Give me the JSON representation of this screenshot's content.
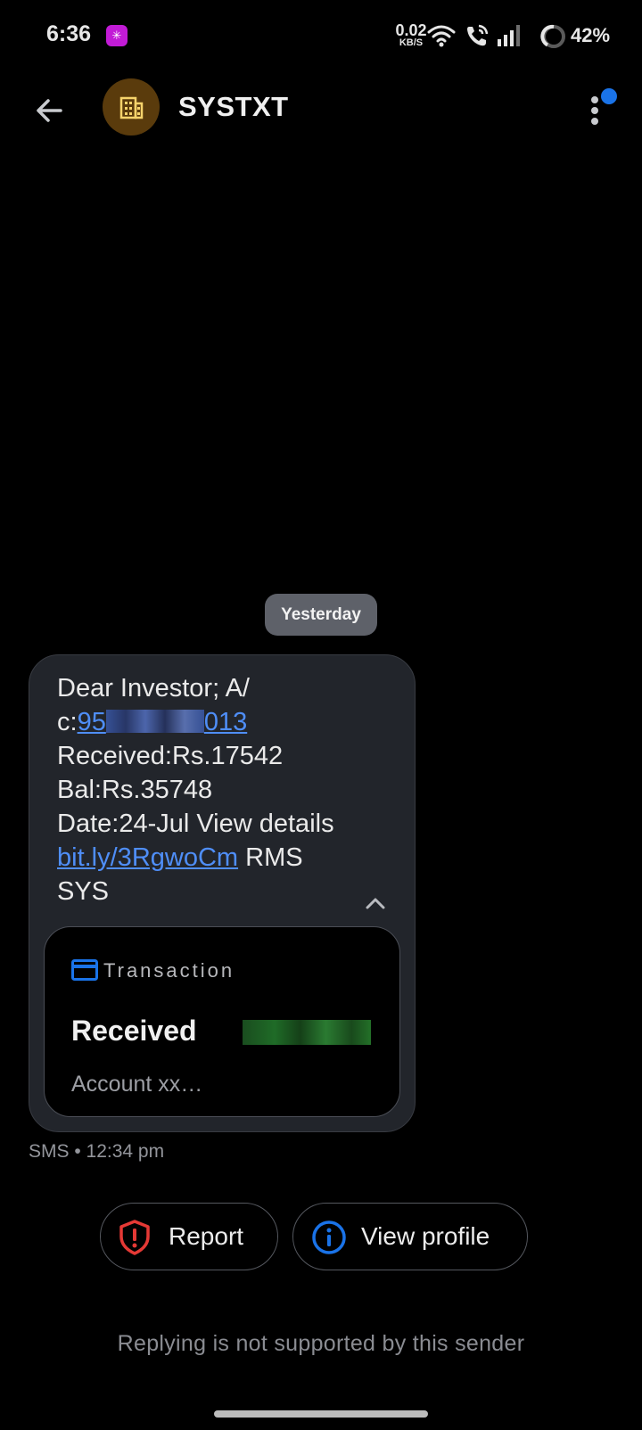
{
  "status_bar": {
    "time": "6:36",
    "app_icon_glyph": "✳",
    "net_speed_value": "0.02",
    "net_speed_unit": "KB/S",
    "battery": "42%",
    "icons": [
      "wifi-icon",
      "wifi-calling-icon",
      "signal-icon",
      "battery-ring-icon"
    ]
  },
  "header": {
    "back_icon": "arrow-left-icon",
    "avatar_icon": "building-icon",
    "contact_name": "SYSTXT",
    "more_icon": "more-vertical-icon",
    "notification_dot_color": "#1a73e8"
  },
  "conversation": {
    "date_label": "Yesterday",
    "message": {
      "line1": "Dear Investor; A/",
      "line2_prefix": "c:",
      "account_link_start": "95",
      "account_link_end": "013",
      "line3": "Received:Rs.17542",
      "line4": "Bal:Rs.35748",
      "line5": "Date:24-Jul View details",
      "short_link": "bit.ly/3RgwoCm",
      "line6_suffix": " RMS",
      "line7": "SYS"
    },
    "transaction_card": {
      "label": "Transaction",
      "title": "Received",
      "subtitle": "Account xx…"
    },
    "meta": "SMS • 12:34 pm"
  },
  "actions": {
    "report_label": "Report",
    "view_profile_label": "View profile"
  },
  "footer_note": "Replying is not supported by this sender",
  "colors": {
    "background": "#000000",
    "bubble": "#22252b",
    "link": "#4f8ef7",
    "report_icon": "#e53935",
    "info_icon": "#1a73e8",
    "avatar_bg": "#5a3b0c",
    "avatar_icon": "#f6d36b"
  }
}
